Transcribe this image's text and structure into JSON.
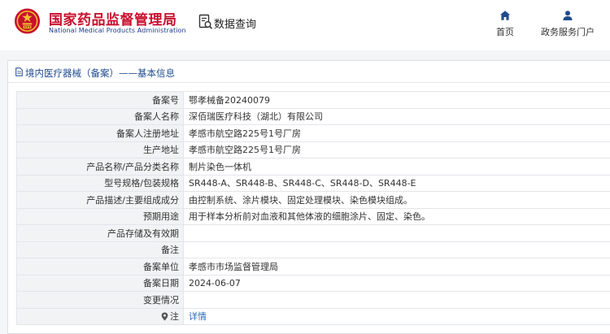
{
  "header": {
    "logo_cn": "国家药品监督管理局",
    "logo_en": "National Medical Products Administration",
    "query_label": "数据查询",
    "nav": [
      {
        "label": "首页",
        "icon": "home-icon"
      },
      {
        "label": "政务服务门户",
        "icon": "user-icon"
      }
    ]
  },
  "panel": {
    "title": "境内医疗器械（备案）——基本信息"
  },
  "rows": [
    {
      "label": "备案号",
      "value": "鄂孝械备20240079"
    },
    {
      "label": "备案人名称",
      "value": "深佰瑞医疗科技（湖北）有限公司"
    },
    {
      "label": "备案人注册地址",
      "value": "孝感市航空路225号1号厂房"
    },
    {
      "label": "生产地址",
      "value": "孝感市航空路225号1号厂房"
    },
    {
      "label": "产品名称/产品分类名称",
      "value": "制片染色一体机"
    },
    {
      "label": "型号规格/包装规格",
      "value": "SR448-A、SR448-B、SR448-C、SR448-D、SR448-E"
    },
    {
      "label": "产品描述/主要组成成分",
      "value": "由控制系统、涂片模块、固定处理模块、染色模块组成。"
    },
    {
      "label": "预期用途",
      "value": "用于样本分析前对血液和其他体液的细胞涂片、固定、染色。"
    },
    {
      "label": "产品存储及有效期",
      "value": ""
    },
    {
      "label": "备注",
      "value": ""
    },
    {
      "label": "备案单位",
      "value": "孝感市市场监督管理局"
    },
    {
      "label": "备案日期",
      "value": "2024-06-07"
    },
    {
      "label": "变更情况",
      "value": ""
    },
    {
      "label": "注",
      "value": "详情"
    }
  ],
  "colors": {
    "brand_red": "#c8102e",
    "brand_blue": "#1f3a8a",
    "link_blue": "#2a6db4"
  }
}
